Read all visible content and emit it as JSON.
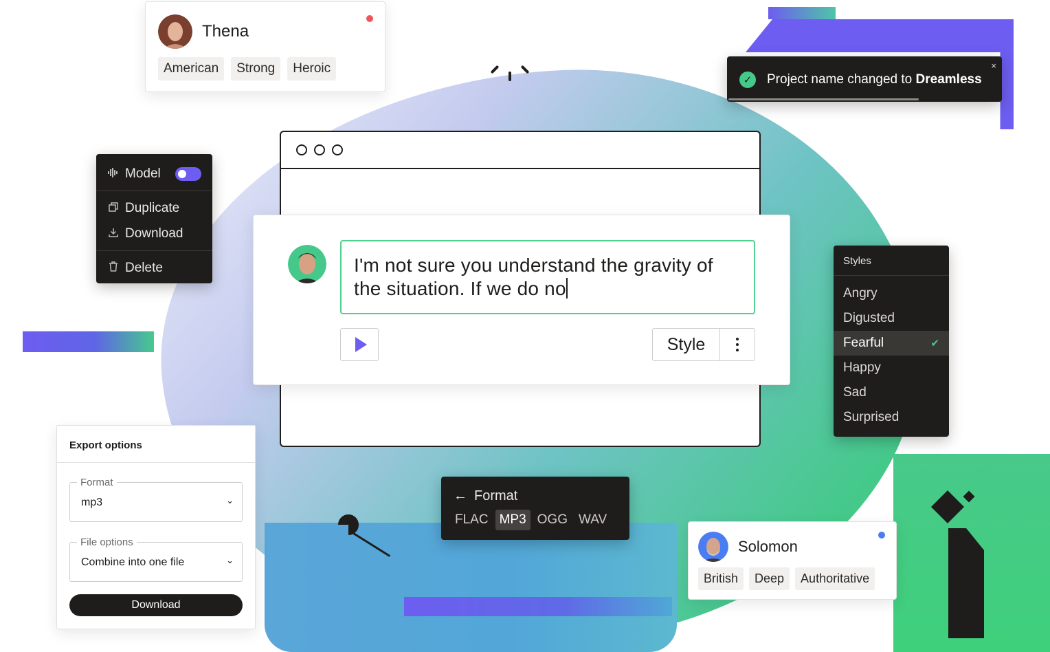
{
  "speaker_thena": {
    "name": "Thena",
    "tags": [
      "American",
      "Strong",
      "Heroic"
    ],
    "status_color": "#f2545b"
  },
  "speaker_solomon": {
    "name": "Solomon",
    "tags": [
      "British",
      "Deep",
      "Authoritative"
    ],
    "status_color": "#4a7cf2"
  },
  "context_menu": {
    "model_label": "Model",
    "model_toggle_on": true,
    "duplicate_label": "Duplicate",
    "download_label": "Download",
    "delete_label": "Delete"
  },
  "toast": {
    "text": "Project name changed to ",
    "project_name": "Dreamless",
    "close": "×",
    "progress": 0.7
  },
  "editor": {
    "text": "I'm not sure you understand the gravity of the situation. If we do no",
    "style_button": "Style"
  },
  "styles_panel": {
    "title": "Styles",
    "items": [
      "Angry",
      "Digusted",
      "Fearful",
      "Happy",
      "Sad",
      "Surprised"
    ],
    "selected": "Fearful"
  },
  "format_popup": {
    "title": "Format",
    "options": [
      "FLAC",
      "MP3",
      "OGG",
      "WAV"
    ],
    "selected": "MP3"
  },
  "export_options": {
    "title": "Export options",
    "format_label": "Format",
    "format_value": "mp3",
    "file_options_label": "File options",
    "file_options_value": "Combine into one file",
    "download_button": "Download"
  },
  "colors": {
    "accent_purple": "#6d5df0",
    "accent_green": "#45c98a",
    "dark_surface": "#1f1d1b"
  }
}
